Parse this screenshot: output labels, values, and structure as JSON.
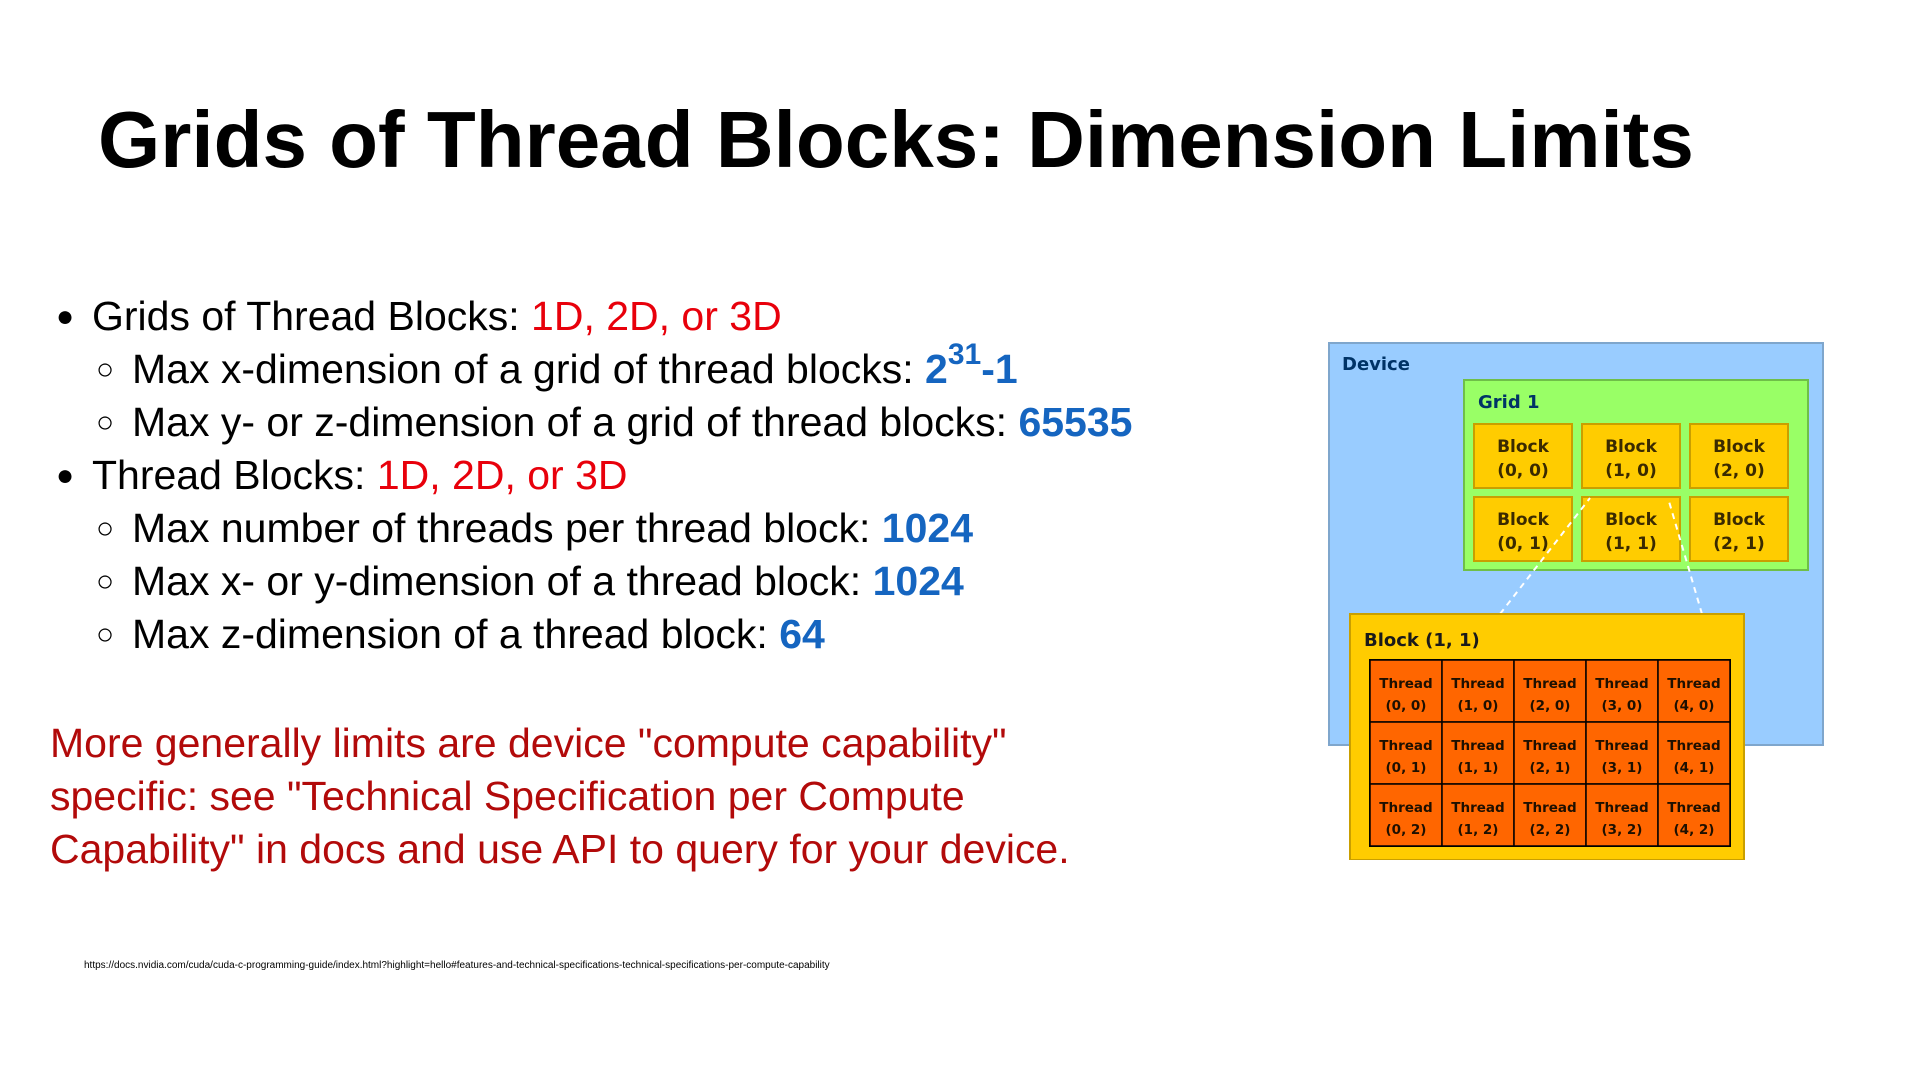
{
  "slide": {
    "title": "Grids of Thread Blocks: Dimension Limits",
    "bullets": [
      {
        "text": "Grids of Thread Blocks: ",
        "highlight": "1D, 2D, or 3D",
        "sub": [
          {
            "text": "Max x-dimension of a grid of thread blocks: ",
            "value_base": "2",
            "value_exp": "31",
            "value_rest": "-1"
          },
          {
            "text": "Max y- or z-dimension of a grid of thread blocks: ",
            "value": "65535"
          }
        ]
      },
      {
        "text": "Thread Blocks: ",
        "highlight": "1D, 2D, or 3D",
        "sub": [
          {
            "text": "Max number of threads per thread block: ",
            "value": "1024"
          },
          {
            "text": "Max x- or y-dimension of a thread block: ",
            "value": "1024"
          },
          {
            "text": "Max z-dimension of a thread block: ",
            "value": "64"
          }
        ]
      }
    ],
    "note_lines": [
      "More generally limits are device \"compute capability\"",
      "specific: see \"Technical Specification per Compute",
      "Capability\" in docs and use API to query for your device."
    ],
    "source_url": "https://docs.nvidia.com/cuda/cuda-c-programming-guide/index.html?highlight=hello#features-and-technical-specifications-technical-specifications-per-compute-capability"
  },
  "diagram": {
    "device_label": "Device",
    "grid_label": "Grid 1",
    "block_word": "Block",
    "blocks": [
      {
        "coord": "(0, 0)"
      },
      {
        "coord": "(1, 0)"
      },
      {
        "coord": "(2, 0)"
      },
      {
        "coord": "(0, 1)"
      },
      {
        "coord": "(1, 1)"
      },
      {
        "coord": "(2, 1)"
      }
    ],
    "expanded_block_label": "Block (1, 1)",
    "thread_word": "Thread",
    "threads": [
      {
        "coord": "(0, 0)"
      },
      {
        "coord": "(1, 0)"
      },
      {
        "coord": "(2, 0)"
      },
      {
        "coord": "(3, 0)"
      },
      {
        "coord": "(4, 0)"
      },
      {
        "coord": "(0, 1)"
      },
      {
        "coord": "(1, 1)"
      },
      {
        "coord": "(2, 1)"
      },
      {
        "coord": "(3, 1)"
      },
      {
        "coord": "(4, 1)"
      },
      {
        "coord": "(0, 2)"
      },
      {
        "coord": "(1, 2)"
      },
      {
        "coord": "(2, 2)"
      },
      {
        "coord": "(3, 2)"
      },
      {
        "coord": "(4, 2)"
      }
    ],
    "colors": {
      "device": "#99ccff",
      "grid": "#99ff66",
      "block": "#ffcc00",
      "thread": "#ff6600",
      "label_dark_blue": "#003366"
    }
  }
}
